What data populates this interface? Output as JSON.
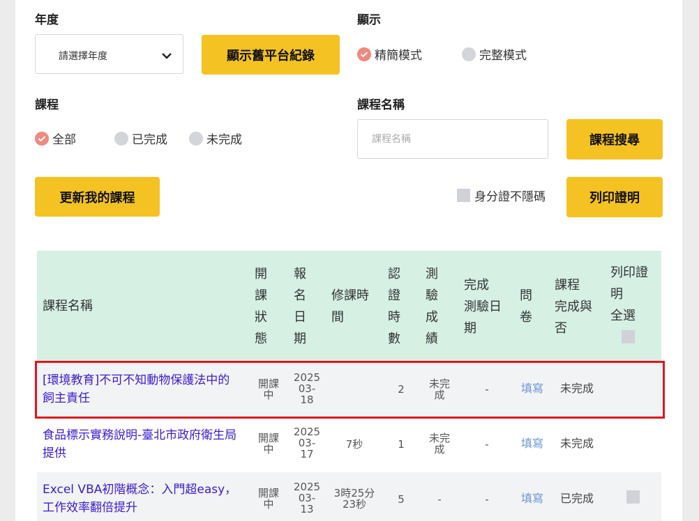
{
  "filters": {
    "year_label": "年度",
    "year_select": "請選擇年度",
    "old_platform_button": "顯示舊平台紀錄",
    "display_label": "顯示",
    "display_options": [
      {
        "label": "精簡模式",
        "selected": true
      },
      {
        "label": "完整模式",
        "selected": false
      }
    ],
    "course_label": "課程",
    "course_options": [
      {
        "label": "全部",
        "selected": true
      },
      {
        "label": "已完成",
        "selected": false
      },
      {
        "label": "未完成",
        "selected": false
      }
    ],
    "course_name_label": "課程名稱",
    "course_name_placeholder": "課程名稱",
    "search_button": "課程搜尋",
    "update_button": "更新我的課程",
    "id_checkbox_label": "身分證不隱碼",
    "print_button": "列印證明"
  },
  "table": {
    "headers": {
      "course_name": "課程名稱",
      "status": [
        "開",
        "課",
        "狀",
        "態"
      ],
      "signup_date": [
        "報",
        "名",
        "日",
        "期"
      ],
      "study_time": [
        "修課時",
        "間"
      ],
      "cert_hours": [
        "認",
        "證",
        "時",
        "數"
      ],
      "test_score": [
        "測",
        "驗",
        "成",
        "績"
      ],
      "test_date": [
        "完成",
        "測驗日",
        "期"
      ],
      "survey": [
        "問",
        "卷"
      ],
      "completed": [
        "課程",
        "完成與",
        "否"
      ],
      "print_all": [
        "列印證",
        "明",
        "全選"
      ]
    },
    "rows": [
      {
        "name": "[環境教育]不可不知動物保護法中的飼主責任",
        "status": [
          "開課",
          "中"
        ],
        "date": [
          "2025",
          "03-",
          "18"
        ],
        "time": [],
        "hours": "2",
        "score": [
          "未完",
          "成"
        ],
        "test_date": "-",
        "survey": "填寫",
        "completed": "未完成",
        "printable": false
      },
      {
        "name": "食品標示實務說明-臺北市政府衛生局提供",
        "status": [
          "開課",
          "中"
        ],
        "date": [
          "2025",
          "03-",
          "17"
        ],
        "time": [
          "7秒"
        ],
        "hours": "1",
        "score": [
          "未完",
          "成"
        ],
        "test_date": "-",
        "survey": "填寫",
        "completed": "未完成",
        "printable": false
      },
      {
        "name": "Excel VBA初階概念：入門超easy，工作效率翻倍提升",
        "status": [
          "開課",
          "中"
        ],
        "date": [
          "2025",
          "03-",
          "13"
        ],
        "time": [
          "3時25分",
          "23秒"
        ],
        "hours": "5",
        "score": [
          "-"
        ],
        "test_date": "-",
        "survey": "填寫",
        "completed": "已完成",
        "printable": true
      }
    ]
  },
  "colors": {
    "accent_button": "#f5c224",
    "header_bg": "#d6f0e4",
    "link": "#3a1bd0",
    "radio_selected": "#ef8a80",
    "highlight_border": "#e2141e"
  }
}
